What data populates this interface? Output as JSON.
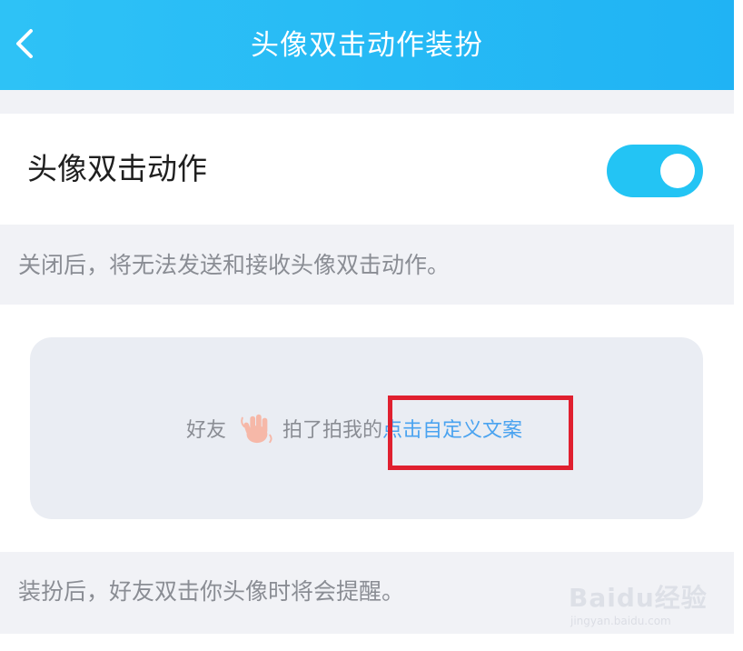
{
  "header": {
    "title": "头像双击动作装扮"
  },
  "settings": {
    "toggle_label": "头像双击动作",
    "toggle_state": "on",
    "toggle_note": "关闭后，将无法发送和接收头像双击动作。"
  },
  "preview": {
    "prefix": "好友",
    "action_text": "拍了拍我的",
    "custom_text_link": "点击自定义文案"
  },
  "footer_note": "装扮后，好友双击你头像时将会提醒。",
  "watermark": {
    "brand": "Baidu经验",
    "url": "jingyan.baidu.com"
  },
  "colors": {
    "header_gradient_start": "#2ec2f6",
    "header_gradient_end": "#20b3f4",
    "toggle_on": "#23c4f4",
    "link": "#4aa3f0",
    "annotation_box": "#e0202f"
  },
  "icons": {
    "back": "chevron-left-icon",
    "wave": "waving-hand-icon"
  }
}
